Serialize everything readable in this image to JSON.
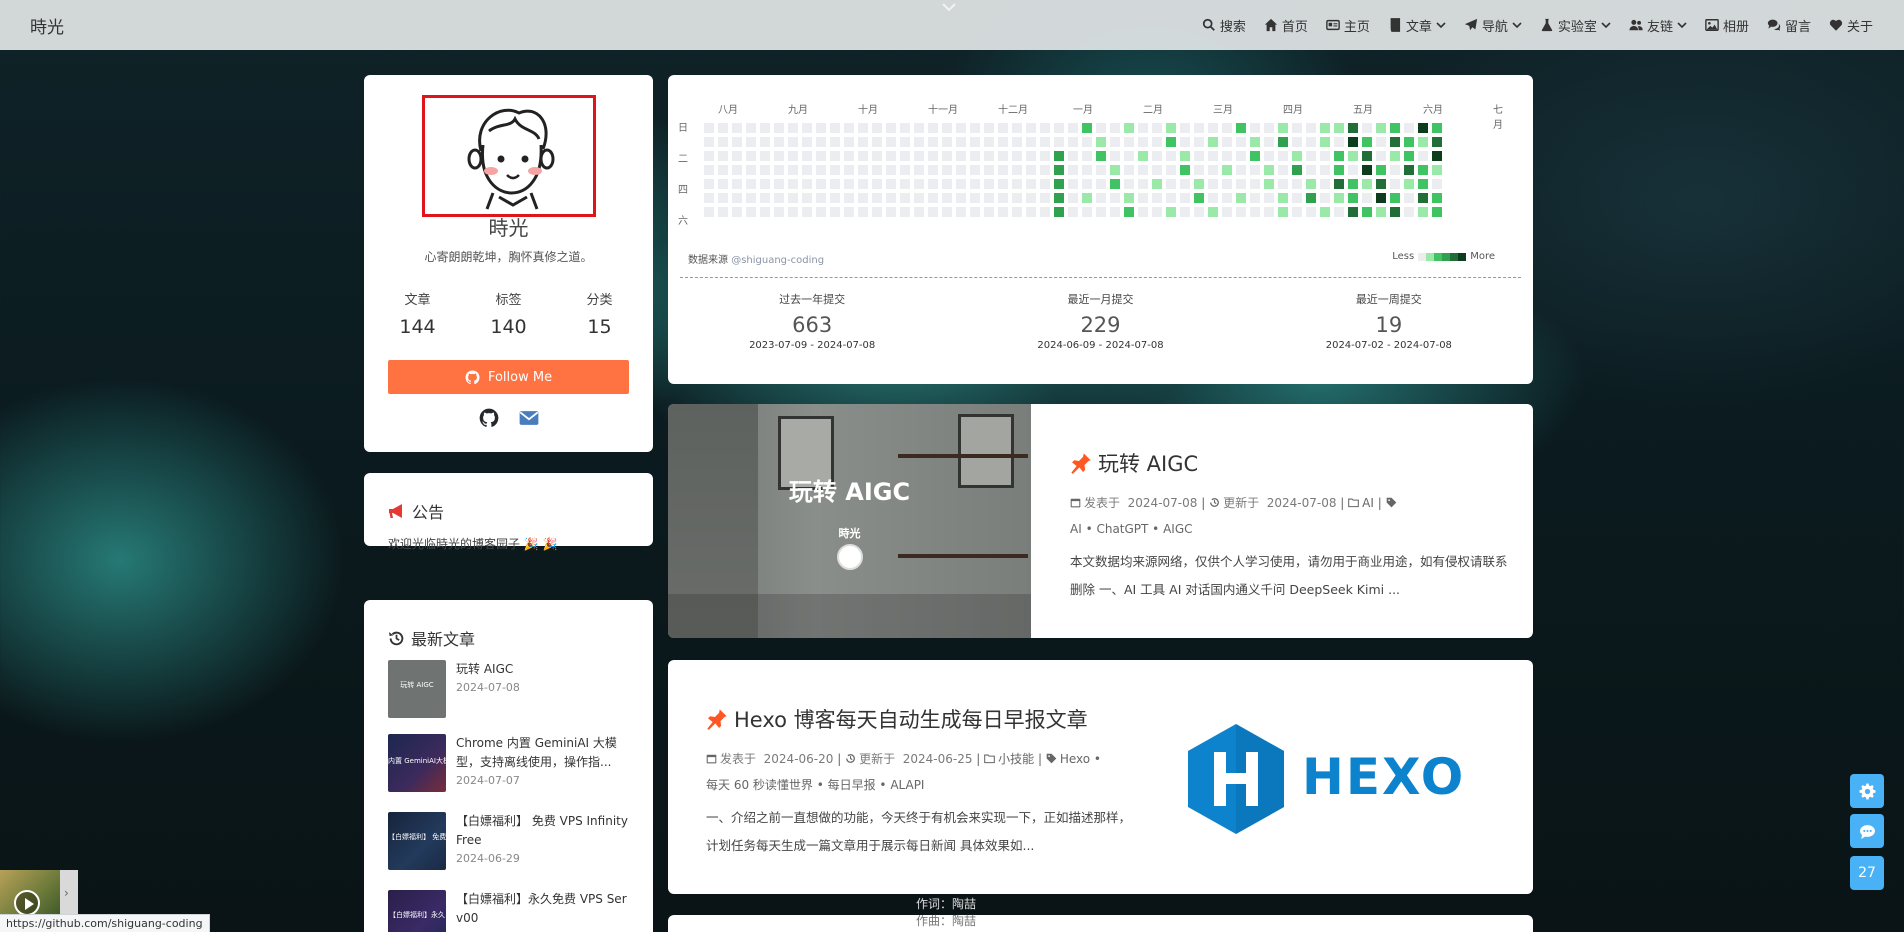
{
  "site": {
    "brand": "時光"
  },
  "nav": [
    {
      "label": "搜索",
      "icon": "search-icon"
    },
    {
      "label": "首页",
      "icon": "home-icon"
    },
    {
      "label": "主页",
      "icon": "id-card-icon"
    },
    {
      "label": "文章",
      "icon": "book-icon",
      "dropdown": true
    },
    {
      "label": "导航",
      "icon": "paper-plane-icon",
      "dropdown": true
    },
    {
      "label": "实验室",
      "icon": "flask-icon",
      "dropdown": true
    },
    {
      "label": "友链",
      "icon": "users-icon",
      "dropdown": true
    },
    {
      "label": "相册",
      "icon": "image-icon"
    },
    {
      "label": "留言",
      "icon": "comments-icon"
    },
    {
      "label": "关于",
      "icon": "heart-icon"
    }
  ],
  "profile": {
    "name": "時光",
    "motto": "心寄朗朗乾坤，胸怀真修之道。",
    "stats": [
      {
        "label": "文章",
        "value": "144"
      },
      {
        "label": "标签",
        "value": "140"
      },
      {
        "label": "分类",
        "value": "15"
      }
    ],
    "follow_label": "Follow Me"
  },
  "notice": {
    "title": "公告",
    "text": "欢迎光临時光的博客园子 🎉 🎉"
  },
  "recent": {
    "title": "最新文章",
    "items": [
      {
        "title": "玩转 AIGC",
        "date": "2024-07-08",
        "thumb_text": "玩转 AIGC"
      },
      {
        "title": "Chrome 内置 GeminiAI 大模型，支持离线使用，操作指...",
        "date": "2024-07-07",
        "thumb_text": "内置 GeminiAI大模"
      },
      {
        "title": "【白嫖福利】 免费 VPS InfinityFree",
        "date": "2024-06-29",
        "thumb_text": "【白嫖福利】 免费"
      },
      {
        "title": "【白嫖福利】永久免费 VPS Serv00",
        "date": "",
        "thumb_text": "【白嫖福利】永久"
      }
    ]
  },
  "heatmap": {
    "months": [
      "八月",
      "九月",
      "十月",
      "十一月",
      "十二月",
      "一月",
      "二月",
      "三月",
      "四月",
      "五月",
      "六月",
      "七月"
    ],
    "weekdays": [
      "日",
      "二",
      "四",
      "六"
    ],
    "source_label": "数据来源",
    "source_user": "@shiguang-coding",
    "legend_less": "Less",
    "legend_more": "More",
    "colors": [
      "#ebedf0",
      "#9be9a8",
      "#40c463",
      "#30a14e",
      "#216e39",
      "#0d3d1d"
    ],
    "stats": [
      {
        "label": "过去一年提交",
        "value": "663",
        "range": "2023-07-09 - 2024-07-08"
      },
      {
        "label": "最近一月提交",
        "value": "229",
        "range": "2024-06-09 - 2024-07-08"
      },
      {
        "label": "最近一周提交",
        "value": "19",
        "range": "2024-07-02 - 2024-07-08"
      }
    ]
  },
  "posts": [
    {
      "title": "玩转 AIGC",
      "cover_title": "玩转 AIGC",
      "cover_author": "時光",
      "published_label": "发表于",
      "published": "2024-07-08",
      "updated_label": "更新于",
      "updated": "2024-07-08",
      "category": "AI",
      "tags": "AI • ChatGPT • AIGC",
      "excerpt": "本文数据均来源网络，仅供个人学习使用，请勿用于商业用途，如有侵权请联系删除 一、AI 工具 AI 对话国内通义千问 DeepSeek Kimi ..."
    },
    {
      "title": "Hexo 博客每天自动生成每日早报文章",
      "published_label": "发表于",
      "published": "2024-06-20",
      "updated_label": "更新于",
      "updated": "2024-06-25",
      "category": "小技能",
      "tags_line1": "Hexo •",
      "tags_line2": "每天 60 秒读懂世界 • 每日早报 • ALAPI",
      "excerpt": "一、介绍之前一直想做的功能，今天终于有机会来实现一下，正如描述那样，计划任务每天生成一篇文章用于展示每日新闻 具体效果如...",
      "cover_logo": "HEXO"
    }
  ],
  "float_badge": "27",
  "lyrics": [
    "作词：陶喆",
    "作曲：陶喆"
  ],
  "status_url": "https://github.com/shiguang-coding"
}
